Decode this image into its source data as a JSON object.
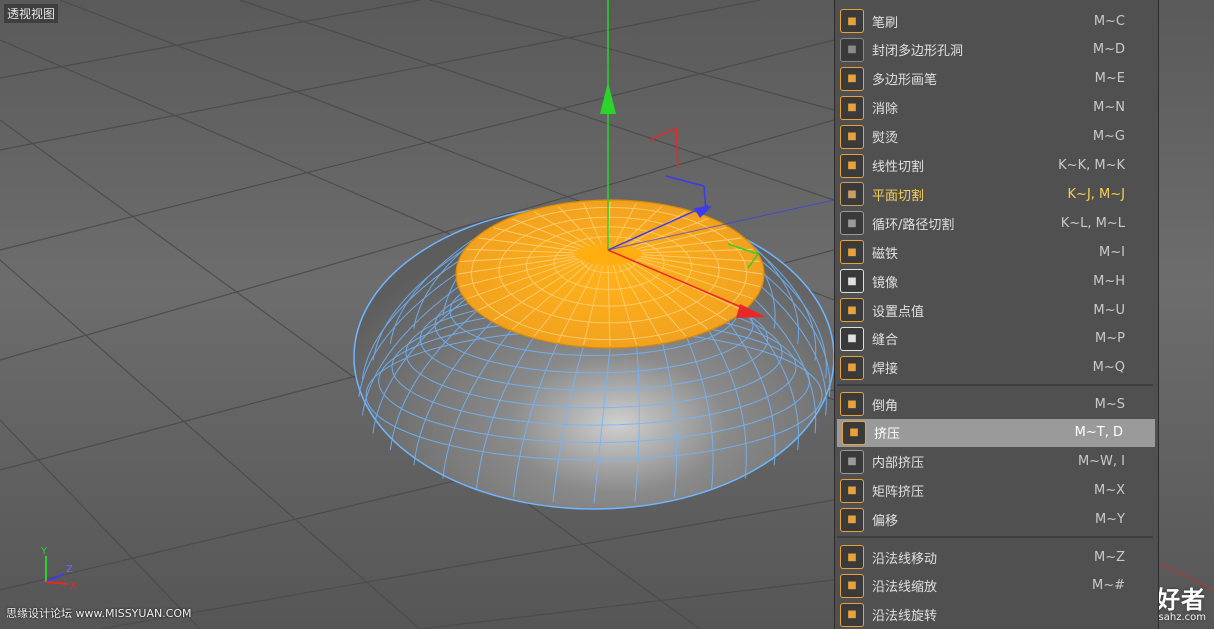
{
  "viewport": {
    "label": "透视视图",
    "axis_labels": {
      "y": "Y",
      "z": "Z",
      "x": "X"
    }
  },
  "menu": {
    "groups": [
      [
        {
          "label": "笔刷",
          "shortcut": "M~C",
          "icon": "brush-icon",
          "color": "#e9a23b"
        },
        {
          "label": "封闭多边形孔洞",
          "shortcut": "M~D",
          "icon": "close-polygon-hole-icon",
          "color": "#8a8a8a"
        },
        {
          "label": "多边形画笔",
          "shortcut": "M~E",
          "icon": "polygon-pen-icon",
          "color": "#e9a23b"
        },
        {
          "label": "消除",
          "shortcut": "M~N",
          "icon": "dissolve-icon",
          "color": "#e9a23b"
        },
        {
          "label": "熨烫",
          "shortcut": "M~G",
          "icon": "iron-icon",
          "color": "#e9a23b"
        },
        {
          "label": "线性切割",
          "shortcut": "K~K, M~K",
          "icon": "line-cut-icon",
          "color": "#e9a23b"
        },
        {
          "label": "平面切割",
          "shortcut": "K~J, M~J",
          "icon": "plane-cut-icon",
          "color": "#c8a060",
          "state": "current"
        },
        {
          "label": "循环/路径切割",
          "shortcut": "K~L, M~L",
          "icon": "loop-cut-icon",
          "color": "#9a9a9a"
        },
        {
          "label": "磁铁",
          "shortcut": "M~I",
          "icon": "magnet-icon",
          "color": "#e9a23b"
        },
        {
          "label": "镜像",
          "shortcut": "M~H",
          "icon": "mirror-icon",
          "color": "#e0e0e0"
        },
        {
          "label": "设置点值",
          "shortcut": "M~U",
          "icon": "set-point-value-icon",
          "color": "#e9a23b"
        },
        {
          "label": "缝合",
          "shortcut": "M~P",
          "icon": "stitch-icon",
          "color": "#e0e0e0"
        },
        {
          "label": "焊接",
          "shortcut": "M~Q",
          "icon": "weld-icon",
          "color": "#e9a23b"
        }
      ],
      [
        {
          "label": "倒角",
          "shortcut": "M~S",
          "icon": "bevel-icon",
          "color": "#e9a23b"
        },
        {
          "label": "挤压",
          "shortcut": "M~T, D",
          "icon": "extrude-icon",
          "color": "#e9a23b",
          "state": "highlight"
        },
        {
          "label": "内部挤压",
          "shortcut": "M~W, I",
          "icon": "extrude-inner-icon",
          "color": "#9a9a9a"
        },
        {
          "label": "矩阵挤压",
          "shortcut": "M~X",
          "icon": "matrix-extrude-icon",
          "color": "#e9a23b"
        },
        {
          "label": "偏移",
          "shortcut": "M~Y",
          "icon": "offset-icon",
          "color": "#e9a23b"
        }
      ],
      [
        {
          "label": "沿法线移动",
          "shortcut": "M~Z",
          "icon": "normal-move-icon",
          "color": "#e9a23b"
        },
        {
          "label": "沿法线缩放",
          "shortcut": "M~#",
          "icon": "normal-scale-icon",
          "color": "#e9a23b"
        },
        {
          "label": "沿法线旋转",
          "shortcut": "",
          "icon": "normal-rotate-icon",
          "color": "#e9a23b"
        }
      ]
    ]
  },
  "watermarks": {
    "left": "思缘设计论坛 www.MISSYUAN.COM",
    "right_big": "PS 爱好者",
    "right_small": "www.psahz.com"
  },
  "colors": {
    "viewport_bg": "#5e5e5e",
    "menu_bg": "#505050",
    "selection_orange": "#f2a81d",
    "wire_blue": "#6fb6ff",
    "highlight_row": "#9a9a9a",
    "current_text": "#f5cf54",
    "axis_y": "#2bd42b",
    "axis_x": "#e8272b",
    "axis_z": "#3b3bf0"
  }
}
